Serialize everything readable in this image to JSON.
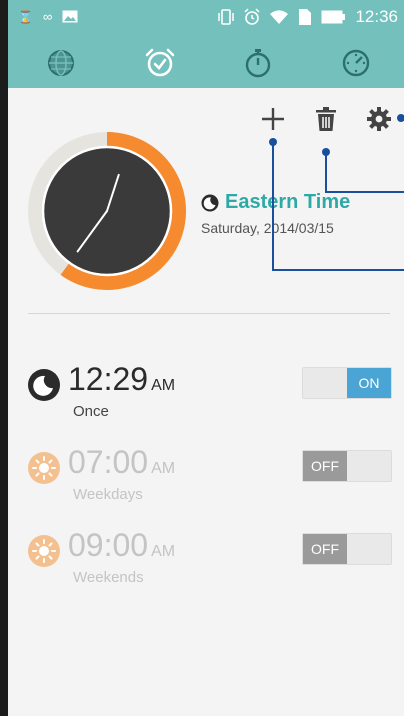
{
  "status_bar": {
    "time": "12:36",
    "icons": [
      "gallery-notification-icon",
      "vibrate-icon",
      "alarm-icon",
      "wifi-icon",
      "sim-icon",
      "battery-icon"
    ]
  },
  "tabs": [
    {
      "name": "world-clock",
      "icon": "globe-icon",
      "active": false
    },
    {
      "name": "alarm",
      "icon": "alarm-clock-icon",
      "active": true
    },
    {
      "name": "stopwatch",
      "icon": "stopwatch-icon",
      "active": false
    },
    {
      "name": "timer",
      "icon": "timer-icon",
      "active": false
    }
  ],
  "actions": [
    {
      "name": "add",
      "icon": "plus-icon"
    },
    {
      "name": "delete",
      "icon": "trash-icon"
    },
    {
      "name": "settings",
      "icon": "gear-icon"
    }
  ],
  "clock": {
    "timezone": "Eastern Time",
    "date": "Saturday, 2014/03/15",
    "hour": 12,
    "minute": 36,
    "ring_color": "#f58a2f",
    "track_color": "#e6e4df",
    "face_color": "#3a3a3a"
  },
  "alarms": [
    {
      "time": "12:29",
      "ampm": "AM",
      "repeat": "Once",
      "icon": "moon-icon",
      "enabled": true,
      "toggle_label": "ON"
    },
    {
      "time": "07:00",
      "ampm": "AM",
      "repeat": "Weekdays",
      "icon": "sun-icon",
      "enabled": false,
      "toggle_label": "OFF"
    },
    {
      "time": "09:00",
      "ampm": "AM",
      "repeat": "Weekends",
      "icon": "sun-icon",
      "enabled": false,
      "toggle_label": "OFF"
    }
  ],
  "colors": {
    "header": "#74c0bd",
    "accent_text": "#2fa9a6",
    "toggle_on": "#4aa4d4",
    "toggle_off": "#9a9a9a",
    "callout_line": "#1a4f9e"
  }
}
